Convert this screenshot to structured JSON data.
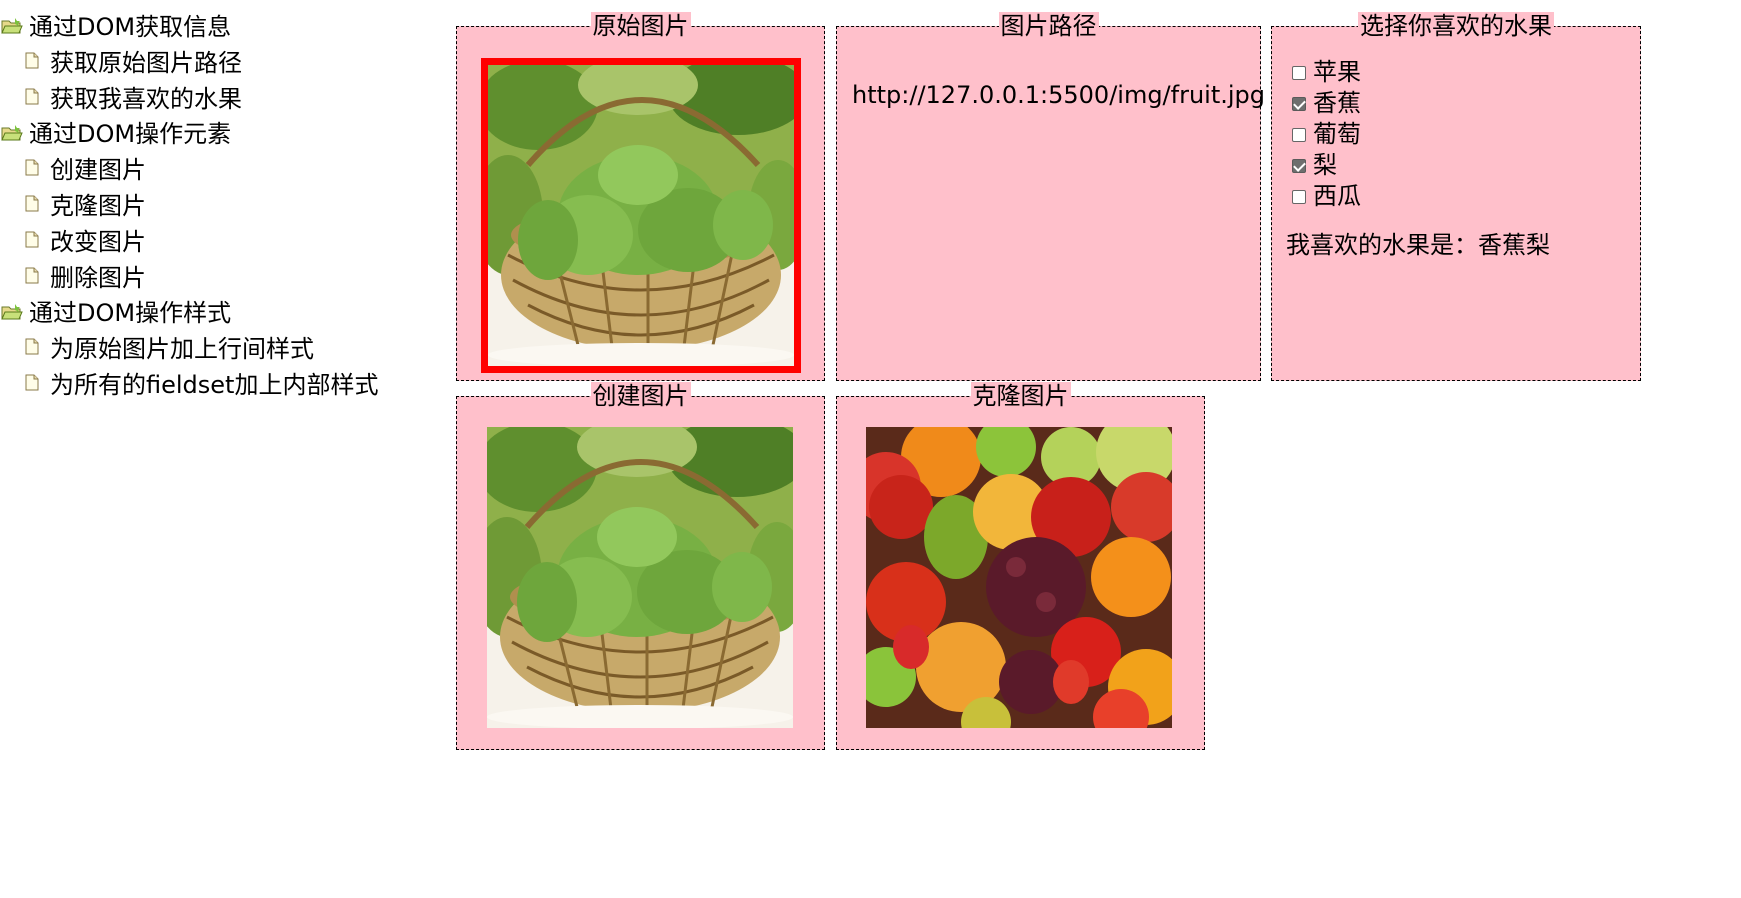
{
  "menu": {
    "groups": [
      {
        "label": "通过DOM获取信息",
        "icon": "folder-open-icon",
        "items": [
          {
            "label": "获取原始图片路径",
            "icon": "page-icon"
          },
          {
            "label": "获取我喜欢的水果",
            "icon": "page-icon"
          }
        ]
      },
      {
        "label": "通过DOM操作元素",
        "icon": "folder-open-icon",
        "items": [
          {
            "label": "创建图片",
            "icon": "page-icon"
          },
          {
            "label": "克隆图片",
            "icon": "page-icon"
          },
          {
            "label": "改变图片",
            "icon": "page-icon"
          },
          {
            "label": "删除图片",
            "icon": "page-icon"
          }
        ]
      },
      {
        "label": "通过DOM操作样式",
        "icon": "folder-open-icon",
        "items": [
          {
            "label": "为原始图片加上行间样式",
            "icon": "page-icon"
          },
          {
            "label": "为所有的fieldset加上内部样式",
            "icon": "page-icon"
          }
        ]
      }
    ]
  },
  "panels": {
    "original": {
      "legend": "原始图片",
      "image": "grape-basket-image",
      "border_color": "#ff0000"
    },
    "path": {
      "legend": "图片路径",
      "value": "http://127.0.0.1:5500/img/fruit.jpg"
    },
    "fruit": {
      "legend": "选择你喜欢的水果",
      "options": [
        {
          "label": "苹果",
          "checked": false
        },
        {
          "label": "香蕉",
          "checked": true
        },
        {
          "label": "葡萄",
          "checked": false
        },
        {
          "label": "梨",
          "checked": true
        },
        {
          "label": "西瓜",
          "checked": false
        }
      ],
      "favorite_text": "我喜欢的水果是：香蕉梨"
    },
    "create": {
      "legend": "创建图片",
      "image": "grape-basket-image"
    },
    "clone": {
      "legend": "克隆图片",
      "image": "mixed-fruit-image"
    }
  },
  "colors": {
    "panel_bg": "#ffc0cb",
    "highlight_border": "#ff0000"
  }
}
